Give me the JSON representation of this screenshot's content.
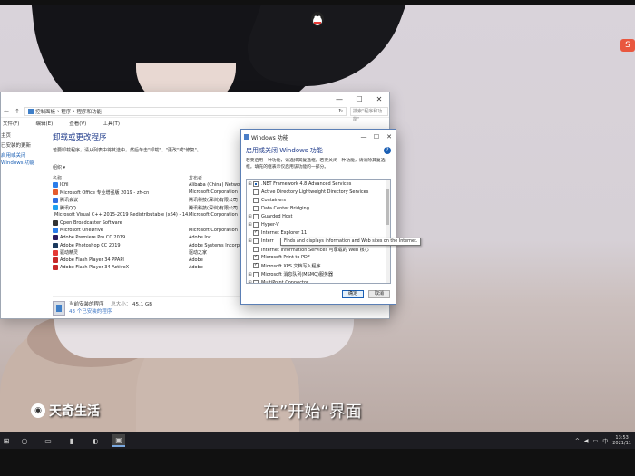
{
  "control_panel": {
    "address": [
      "控制面板",
      "程序",
      "程序和功能"
    ],
    "search_placeholder": "搜索\"程序和功能\"",
    "menu": [
      "文件(F)",
      "编辑(E)",
      "查看(V)",
      "工具(T)"
    ],
    "sidebar": [
      "主页",
      "已安装的更新",
      "启用或关闭 Windows 功能"
    ],
    "heading": "卸载或更改程序",
    "description": "若要卸载程序，请从列表中将其选中，然后单击\"卸载\"、\"更改\"或\"修复\"。",
    "organize_label": "组织 ▾",
    "col_name": "名称",
    "col_publisher": "发布者",
    "programs": [
      {
        "name": "ICfil",
        "publisher": "Alibaba (China) Network Te",
        "color": "#2b7de9"
      },
      {
        "name": "Microsoft Office 专业增强版 2019 - zh-cn",
        "publisher": "Microsoft Corporation",
        "color": "#e55b2d"
      },
      {
        "name": "腾讯会议",
        "publisher": "腾讯科技(深圳)有限公司",
        "color": "#2f6ee0"
      },
      {
        "name": "腾讯QQ",
        "publisher": "腾讯科技(深圳)有限公司",
        "color": "#1ea0f0"
      },
      {
        "name": "Microsoft Visual C++ 2015-2019 Redistributable (x64) - 14.2...",
        "publisher": "Microsoft Corporation",
        "color": "#7f5fa8"
      },
      {
        "name": "Open Broadcaster Software",
        "publisher": "",
        "color": "#333333"
      },
      {
        "name": "Microsoft OneDrive",
        "publisher": "Microsoft Corporation",
        "color": "#2b7de9"
      },
      {
        "name": "Adobe Premiere Pro CC 2019",
        "publisher": "Adobe Inc.",
        "color": "#2a1b5e"
      },
      {
        "name": "Adobe Photoshop CC 2019",
        "publisher": "Adobe Systems Incorporat",
        "color": "#1b3a5e"
      },
      {
        "name": "驱动精灵",
        "publisher": "驱动之家",
        "color": "#e53935"
      },
      {
        "name": "Adobe Flash Player 34 PPAPI",
        "publisher": "Adobe",
        "color": "#c62828"
      },
      {
        "name": "Adobe Flash Player 34 ActiveX",
        "publisher": "Adobe",
        "color": "#c62828"
      }
    ],
    "footer_title": "当前安装的程序",
    "footer_size_label": "总大小：",
    "footer_size": "45.1 GB",
    "footer_count": "43 个已安装的程序"
  },
  "features_dialog": {
    "window_title": "Windows 功能",
    "title": "启用或关闭 Windows 功能",
    "description": "若要启用一种功能，请选择其复选框。若要关闭一种功能，请清除其复选框。填充的框表示仅启用该功能的一部分。",
    "features": [
      {
        "expander": "⊞",
        "state": "partial",
        "label": ".NET Framework 4.8 Advanced Services"
      },
      {
        "expander": "",
        "state": "unchecked",
        "label": "Active Directory Lightweight Directory Services"
      },
      {
        "expander": "",
        "state": "unchecked",
        "label": "Containers"
      },
      {
        "expander": "",
        "state": "unchecked",
        "label": "Data Center Bridging"
      },
      {
        "expander": "⊞",
        "state": "unchecked",
        "label": "Guarded Host"
      },
      {
        "expander": "⊞",
        "state": "unchecked",
        "label": "Hyper-V"
      },
      {
        "expander": "",
        "state": "checked",
        "label": "Internet Explorer 11"
      },
      {
        "expander": "⊞",
        "state": "unchecked",
        "label": "Interr"
      },
      {
        "expander": "",
        "state": "unchecked",
        "label": "Internet Information Services 可承载的 Web 核心"
      },
      {
        "expander": "",
        "state": "checked",
        "label": "Microsoft Print to PDF"
      },
      {
        "expander": "",
        "state": "checked",
        "label": "Microsoft XPS 文档写入程序"
      },
      {
        "expander": "⊞",
        "state": "unchecked",
        "label": "Microsoft 消息队列(MSMQ)服务器"
      },
      {
        "expander": "⊞",
        "state": "unchecked",
        "label": "MultiPoint Connector"
      }
    ],
    "tooltip": "Finds and displays information and Web sites on the Internet.",
    "ok_label": "确定",
    "cancel_label": "取消"
  },
  "overlay": {
    "subtitle": "在”开始“界面",
    "watermark": "天奇生活"
  },
  "taskbar": {
    "clock_time": "13:53",
    "clock_date": "2021/11"
  }
}
